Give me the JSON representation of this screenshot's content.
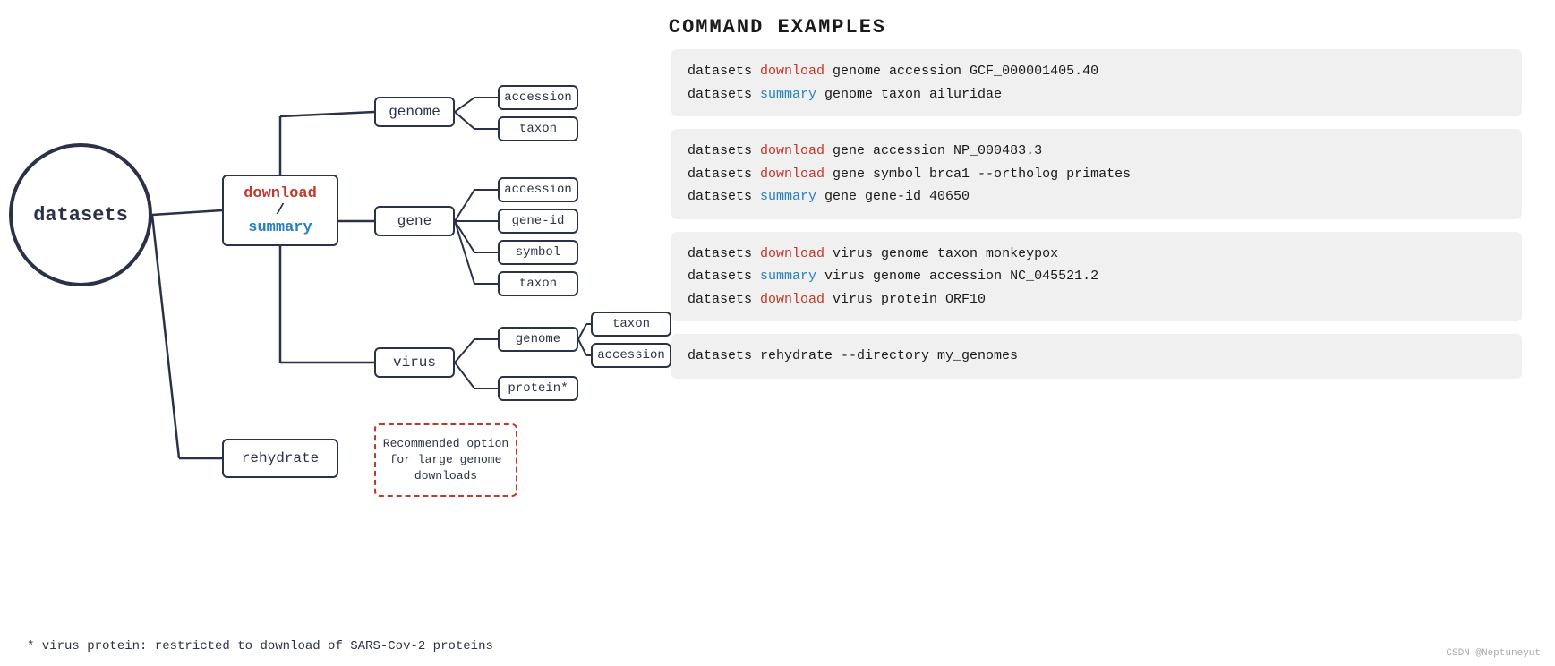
{
  "page": {
    "title": "COMMAND EXAMPLES",
    "datasets_label": "datasets",
    "download_text": "download",
    "slash": "/",
    "summary_text": "summary",
    "nodes": {
      "genome": "genome",
      "gene": "gene",
      "virus": "virus",
      "rehydrate": "rehydrate",
      "g_accession": "accession",
      "g_taxon": "taxon",
      "gene_accession": "accession",
      "gene_geneid": "gene-id",
      "gene_symbol": "symbol",
      "gene_taxon": "taxon",
      "virus_genome": "genome",
      "virus_protein": "protein*",
      "vg_taxon": "taxon",
      "vg_accession": "accession"
    },
    "recommended_box": "Recommended option for large genome downloads",
    "commands": {
      "genome": [
        {
          "parts": [
            {
              "text": "datasets ",
              "color": "normal"
            },
            {
              "text": "download",
              "color": "download"
            },
            {
              "text": " genome accession GCF_000001405.40",
              "color": "normal"
            }
          ]
        },
        {
          "parts": [
            {
              "text": "datasets ",
              "color": "normal"
            },
            {
              "text": "summary",
              "color": "summary"
            },
            {
              "text": "  genome taxon ailuridae",
              "color": "normal"
            }
          ]
        }
      ],
      "gene": [
        {
          "parts": [
            {
              "text": "datasets ",
              "color": "normal"
            },
            {
              "text": "download",
              "color": "download"
            },
            {
              "text": " gene accession NP_000483.3",
              "color": "normal"
            }
          ]
        },
        {
          "parts": [
            {
              "text": "datasets ",
              "color": "normal"
            },
            {
              "text": "download",
              "color": "download"
            },
            {
              "text": " gene symbol brca1 --ortholog primates",
              "color": "normal"
            }
          ]
        },
        {
          "parts": [
            {
              "text": "datasets ",
              "color": "normal"
            },
            {
              "text": "summary",
              "color": "summary"
            },
            {
              "text": "  gene gene-id 40650",
              "color": "normal"
            }
          ]
        }
      ],
      "virus": [
        {
          "parts": [
            {
              "text": "datasets ",
              "color": "normal"
            },
            {
              "text": "download",
              "color": "download"
            },
            {
              "text": " virus genome taxon monkeypox",
              "color": "normal"
            }
          ]
        },
        {
          "parts": [
            {
              "text": "datasets ",
              "color": "normal"
            },
            {
              "text": "summary",
              "color": "summary"
            },
            {
              "text": "  virus genome accession NC_045521.2",
              "color": "normal"
            }
          ]
        },
        {
          "parts": [
            {
              "text": "datasets ",
              "color": "normal"
            },
            {
              "text": "download",
              "color": "download"
            },
            {
              "text": " virus protein ORF10",
              "color": "normal"
            }
          ]
        }
      ],
      "rehydrate": [
        {
          "parts": [
            {
              "text": "datasets ",
              "color": "normal"
            },
            {
              "text": "rehydrate --directory my_genomes",
              "color": "normal"
            }
          ]
        }
      ]
    },
    "footnote": "* virus protein: restricted to download of SARS-Cov-2 proteins",
    "watermark": "CSDN @Neptuneyut"
  }
}
